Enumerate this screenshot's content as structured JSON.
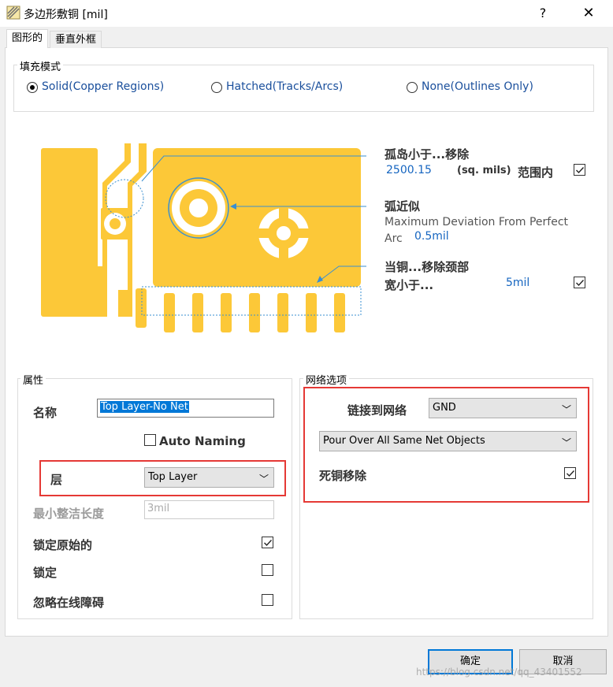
{
  "window": {
    "title": "多边形敷铜 [mil]",
    "help": "?",
    "close": "✕"
  },
  "tabs": [
    {
      "label": "图形的",
      "active": true
    },
    {
      "label": "垂直外框",
      "active": false
    }
  ],
  "fill_mode": {
    "label": "填充模式",
    "options": [
      {
        "label": "Solid(Copper Regions)",
        "selected": true
      },
      {
        "label": "Hatched(Tracks/Arcs)",
        "selected": false
      },
      {
        "label": "None(Outlines Only)",
        "selected": false
      }
    ]
  },
  "diagram": {
    "island": {
      "title": "孤岛小于...移除",
      "value": "2500.15",
      "unit": "(sq. mils)",
      "suffix": "范围内",
      "checked": true
    },
    "arc": {
      "title": "弧近似",
      "desc_line1": "Maximum Deviation From Perfect",
      "desc_line2": "Arc",
      "value": "0.5mil"
    },
    "neck": {
      "title_line1": "当铜...移除颈部",
      "title_line2": "宽小于...",
      "value": "5mil",
      "checked": true
    },
    "colors": {
      "copper": "#fcc838",
      "leader": "#3a8fd0"
    }
  },
  "properties": {
    "label": "属性",
    "name_label": "名称",
    "name_value": "Top Layer-No Net",
    "auto_naming_label": "Auto Naming",
    "auto_naming_checked": false,
    "layer_label": "层",
    "layer_value": "Top Layer",
    "min_prim_label": "最小整洁长度",
    "min_prim_placeholder": "3mil",
    "lock_primitives_label": "锁定原始的",
    "lock_primitives_checked": true,
    "locked_label": "锁定",
    "locked_checked": false,
    "ignore_obstacles_label": "忽略在线障碍",
    "ignore_obstacles_checked": false
  },
  "net_options": {
    "label": "网络选项",
    "connect_label": "链接到网络",
    "connect_value": "GND",
    "pour_value": "Pour Over All Same Net Objects",
    "remove_dead_label": "死铜移除",
    "remove_dead_checked": true
  },
  "buttons": {
    "ok": "确定",
    "cancel": "取消"
  },
  "watermark": "https://blog.csdn.net/qq_43401552"
}
